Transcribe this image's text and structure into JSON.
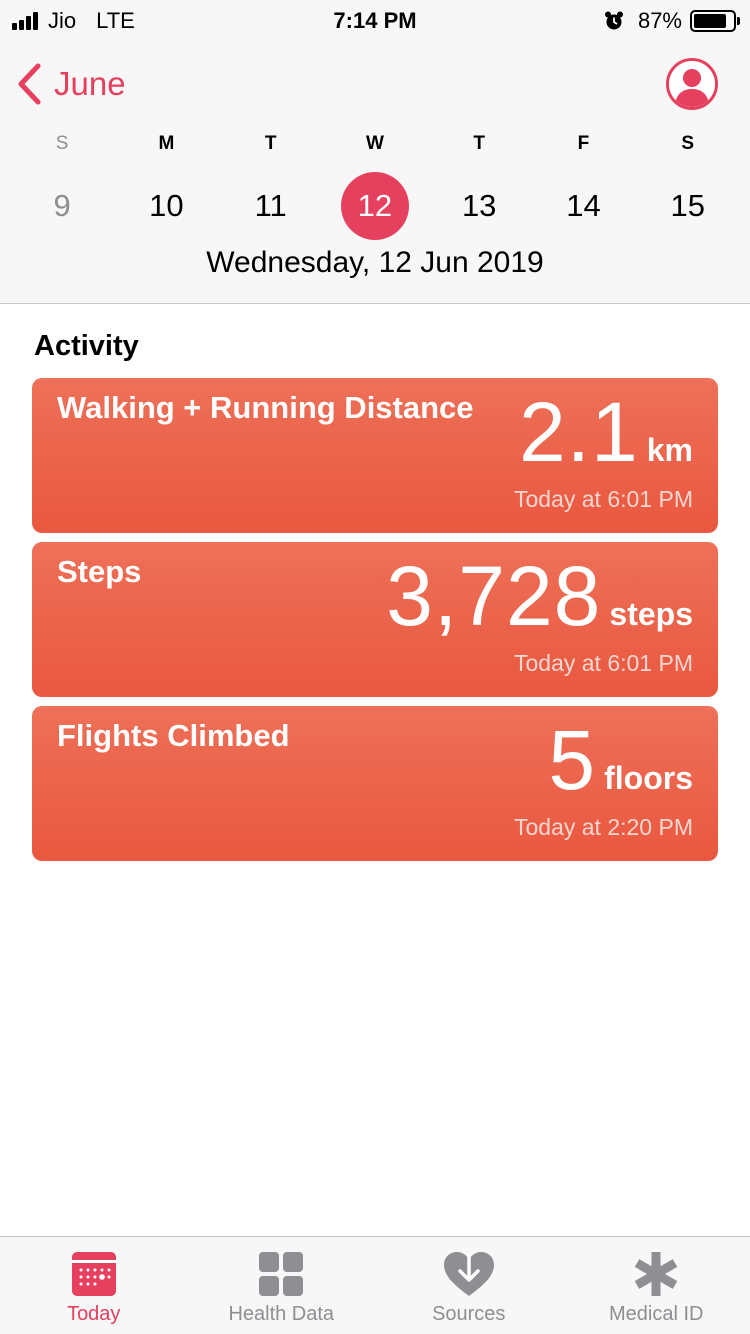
{
  "status_bar": {
    "carrier": "Jio",
    "network": "LTE",
    "time": "7:14 PM",
    "battery": "87%"
  },
  "nav": {
    "back_label": "June"
  },
  "week": {
    "letters": [
      "S",
      "M",
      "T",
      "W",
      "T",
      "F",
      "S"
    ],
    "days": [
      "9",
      "10",
      "11",
      "12",
      "13",
      "14",
      "15"
    ],
    "selected_index": 3
  },
  "selected_date": "Wednesday, 12 Jun 2019",
  "section_title": "Activity",
  "cards": [
    {
      "title": "Walking + Running Distance",
      "value": "2.1",
      "unit": "km",
      "time": "Today at 6:01 PM"
    },
    {
      "title": "Steps",
      "value": "3,728",
      "unit": "steps",
      "time": "Today at 6:01 PM"
    },
    {
      "title": "Flights Climbed",
      "value": "5",
      "unit": "floors",
      "time": "Today at 2:20 PM"
    }
  ],
  "tabs": [
    {
      "label": "Today",
      "icon": "calendar-icon",
      "active": true
    },
    {
      "label": "Health Data",
      "icon": "grid-icon",
      "active": false
    },
    {
      "label": "Sources",
      "icon": "heart-download-icon",
      "active": false
    },
    {
      "label": "Medical ID",
      "icon": "asterisk-icon",
      "active": false
    }
  ],
  "colors": {
    "accent": "#e5405e",
    "card": "#ec6449"
  }
}
